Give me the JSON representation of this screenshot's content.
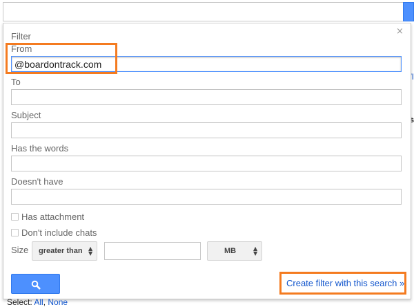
{
  "filter": {
    "title": "Filter",
    "close_glyph": "×",
    "from_label": "From",
    "from_value": "@boardontrack.com",
    "to_label": "To",
    "to_value": "",
    "subject_label": "Subject",
    "subject_value": "",
    "has_words_label": "Has the words",
    "has_words_value": "",
    "doesnt_have_label": "Doesn't have",
    "doesnt_have_value": "",
    "has_attachment_label": "Has attachment",
    "has_attachment_checked": false,
    "dont_include_chats_label": "Don't include chats",
    "dont_include_chats_checked": false,
    "size_label": "Size",
    "size_comparator": "greater than",
    "size_value": "",
    "size_unit": "MB",
    "search_button_icon": "search-icon",
    "create_filter_label": "Create filter with this search »"
  },
  "background": {
    "edge_link_fragment": "/I",
    "edge_bold_fragment": "s",
    "select_prefix": "Select:",
    "select_all": "All",
    "select_none": "None"
  },
  "colors": {
    "highlight": "#f47b20",
    "link": "#1155cc",
    "button_blue": "#4d90fe",
    "label_gray": "#666666"
  }
}
